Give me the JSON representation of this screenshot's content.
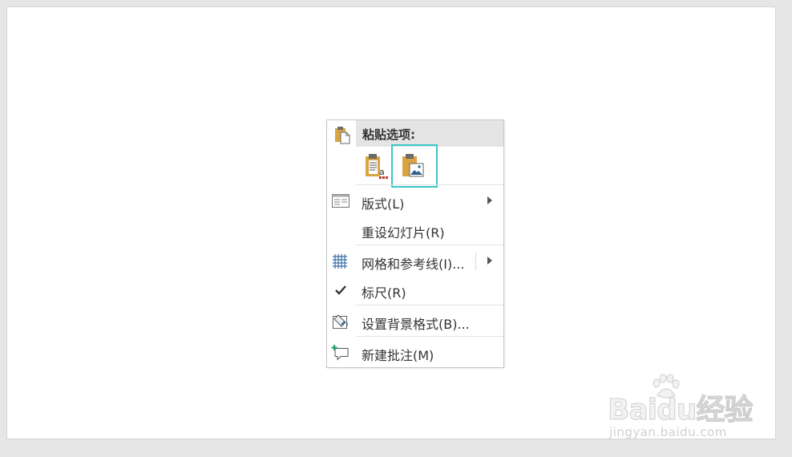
{
  "menu": {
    "header_label": "粘贴选项:",
    "paste_options": [
      {
        "icon": "paste-keep-text-icon"
      },
      {
        "icon": "paste-picture-icon",
        "selected": true
      }
    ],
    "items": [
      {
        "label": "版式(L)",
        "icon": "layout-icon",
        "submenu": true
      },
      {
        "label": "重设幻灯片(R)",
        "icon": "",
        "submenu": false
      },
      {
        "label": "网格和参考线(I)...",
        "icon": "grid-icon",
        "submenu": true
      },
      {
        "label": "标尺(R)",
        "icon": "checkmark-icon",
        "submenu": false,
        "checked": true
      },
      {
        "label": "设置背景格式(B)...",
        "icon": "background-format-icon",
        "submenu": false
      },
      {
        "label": "新建批注(M)",
        "icon": "new-comment-icon",
        "submenu": false
      }
    ]
  },
  "watermark": {
    "logo": "Baidu经验",
    "url": "jingyan.baidu.com"
  },
  "colors": {
    "selection_border": "#3cc8c8",
    "header_bg": "#e4e4e4",
    "clipboard": "#d9a441"
  }
}
